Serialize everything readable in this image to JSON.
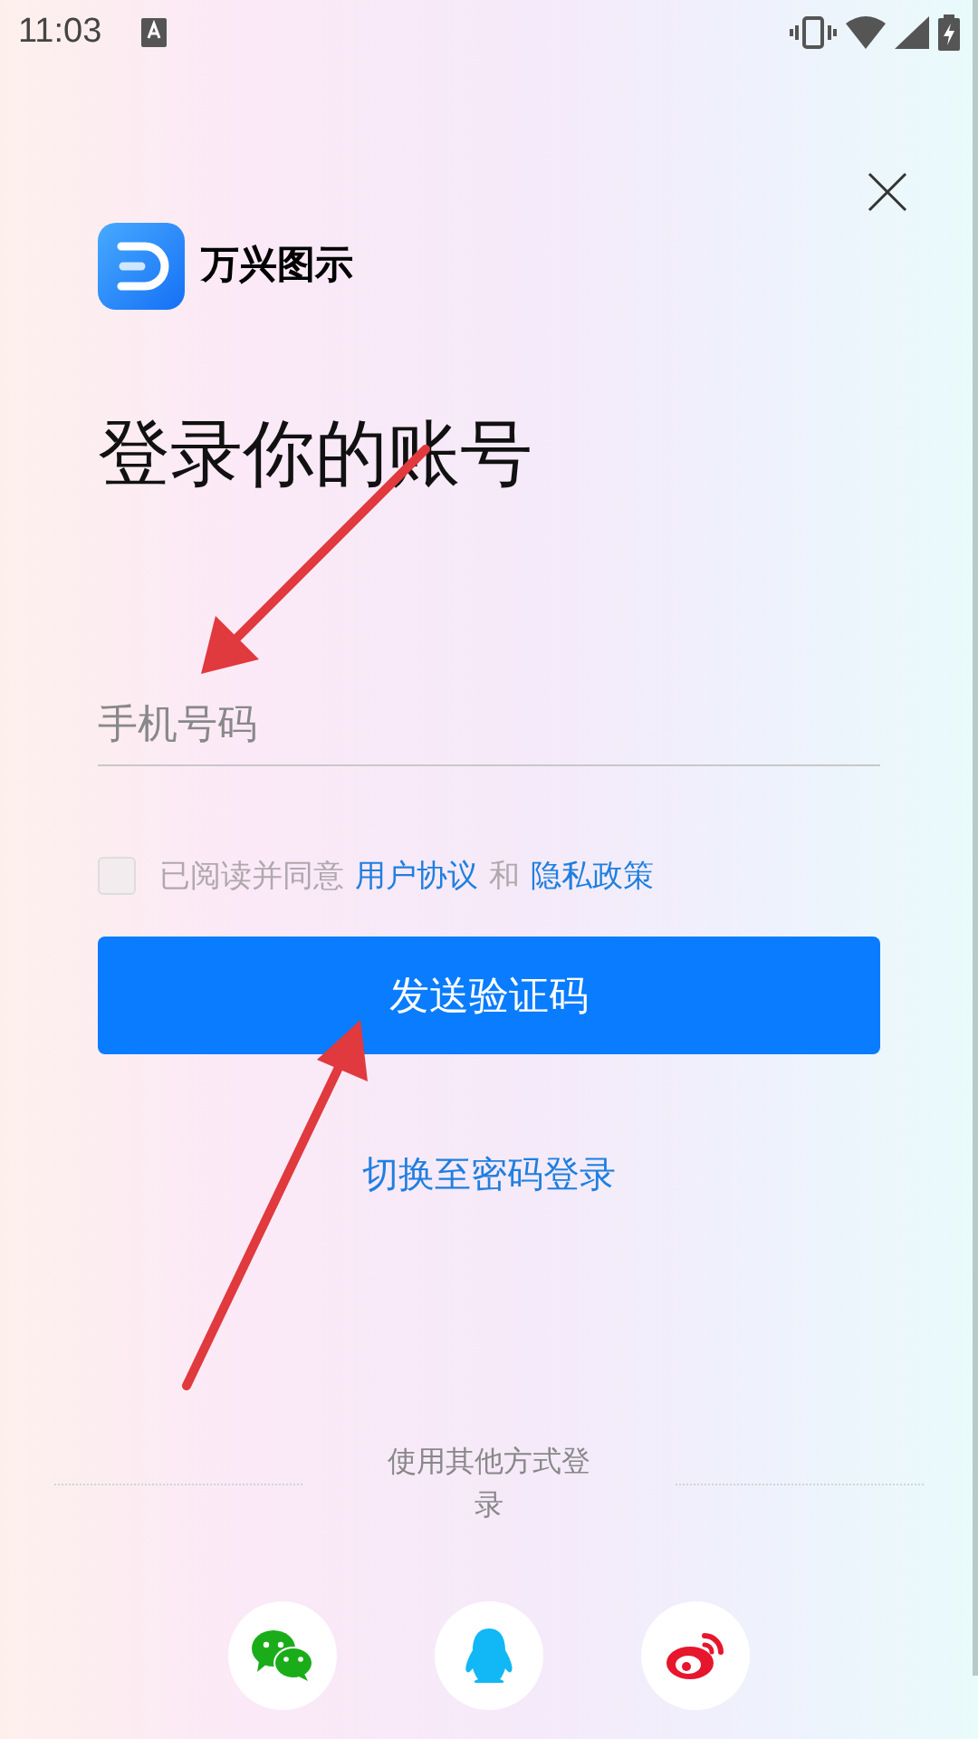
{
  "status_bar": {
    "time": "11:03"
  },
  "logo": {
    "name": "万兴图示"
  },
  "title": "登录你的账号",
  "phone_field": {
    "placeholder": "手机号码"
  },
  "agreement": {
    "checked": false,
    "prefix": "已阅读并同意",
    "link_1": "用户协议",
    "joiner": "和",
    "link_2": "隐私政策"
  },
  "primary_button": "发送验证码",
  "switch_link": "切换至密码登录",
  "other_login": {
    "label": "使用其他方式登录",
    "methods": [
      {
        "kind": "wechat"
      },
      {
        "kind": "qq"
      },
      {
        "kind": "weibo"
      }
    ]
  }
}
